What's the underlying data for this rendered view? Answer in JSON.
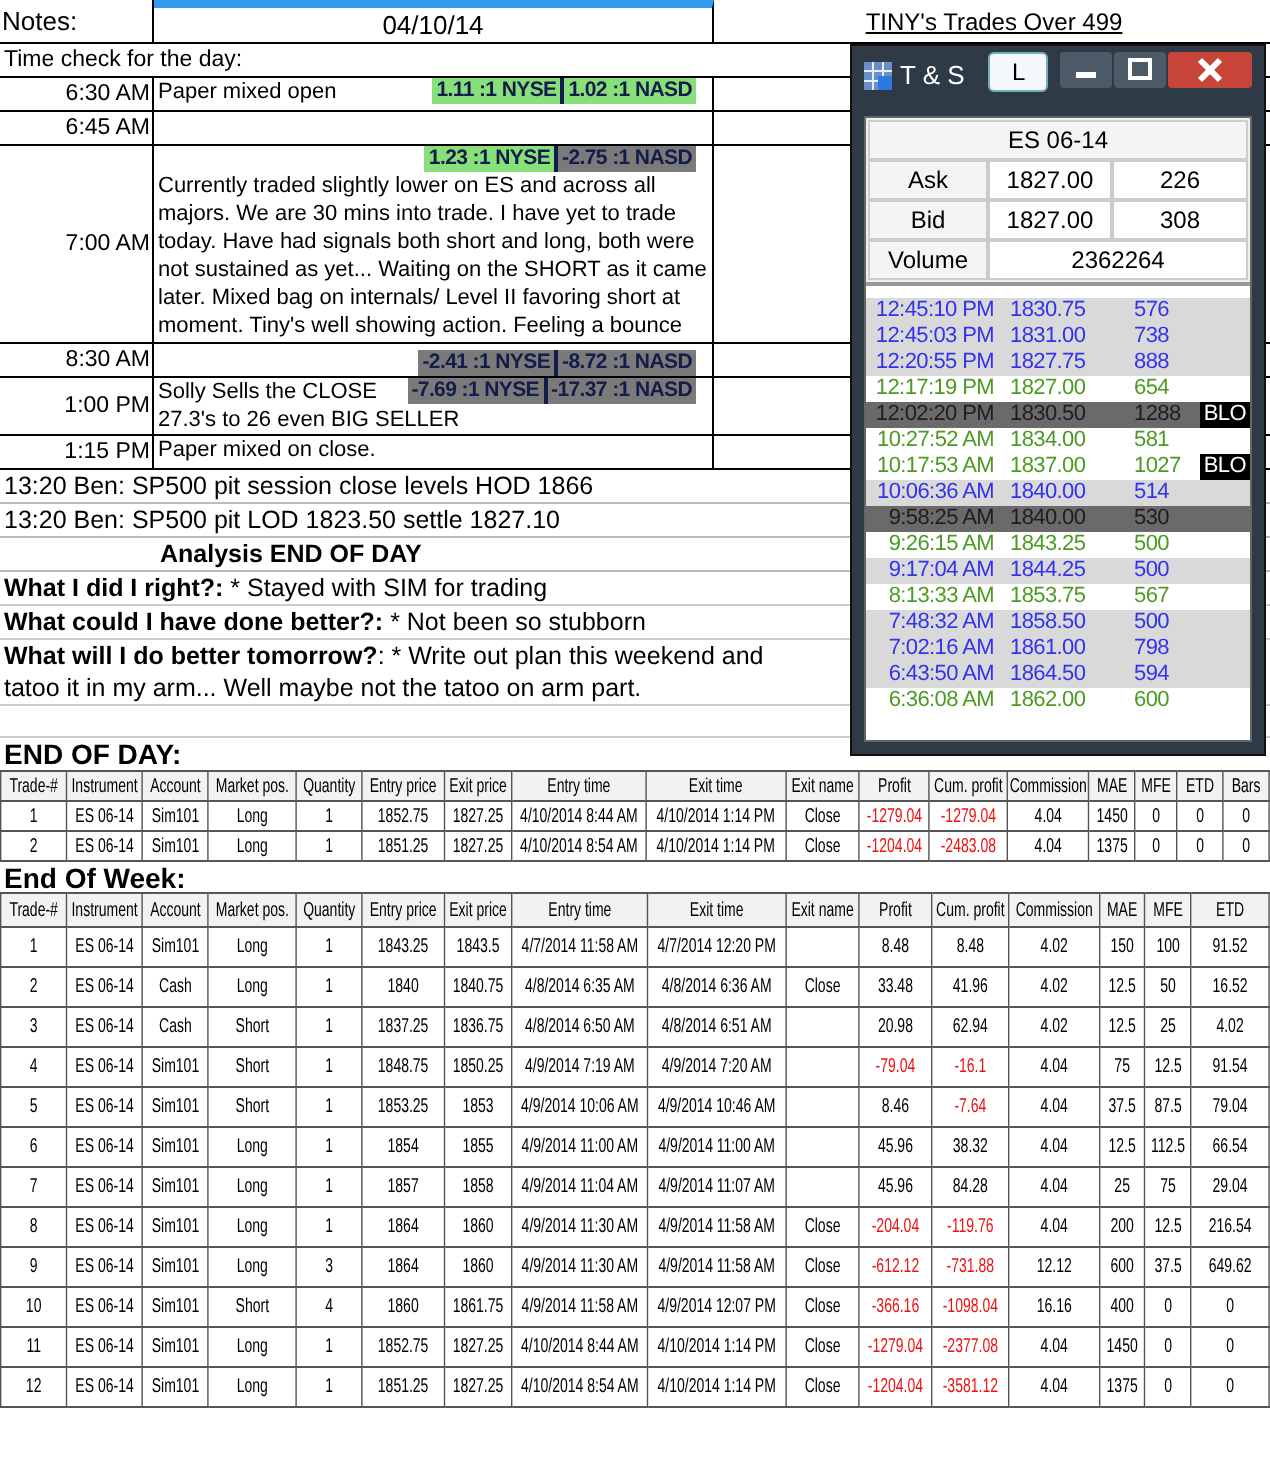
{
  "sheet": {
    "notes_label": "Notes:",
    "date": "04/10/14",
    "title": "TINY's Trades Over 499",
    "time_check": "Time check for the day:",
    "time_rows": [
      {
        "time": "6:30 AM",
        "kind": "overlay",
        "lines": [
          "Paper mixed open"
        ],
        "badges": [
          {
            "text": "1.11 :1 NYSE",
            "color": "#88e07a"
          },
          {
            "text": "1.02 :1 NASD",
            "color": "#88e07a"
          }
        ]
      },
      {
        "time": "6:45 AM",
        "kind": "overlay",
        "badges": []
      },
      {
        "time": "7:00 AM",
        "kind": "stacked",
        "lines": [
          "Currently traded slightly lower on ES and across all majors.   We are 30 mins into trade.  I have yet to trade today. Have had signals both short and long, both were not sustained as yet... Waiting on the SHORT as it came later.  Mixed bag on internals/ Level II favoring short at moment.  Tiny's well showing action.  Feeling a bounce"
        ],
        "badges": [
          {
            "text": "1.23 :1 NYSE",
            "color": "#88e07a"
          },
          {
            "text": "-2.75 :1 NASD",
            "color": "#7a7a7a"
          }
        ]
      },
      {
        "time": "8:30 AM",
        "kind": "overlay",
        "badges": [
          {
            "text": "-2.41 :1 NYSE",
            "color": "#7a7a7a"
          },
          {
            "text": "-8.72 :1 NASD",
            "color": "#7a7a7a"
          }
        ]
      },
      {
        "time": "1:00 PM",
        "kind": "overlay",
        "lines": [
          "Solly Sells the CLOSE",
          "27.3's to 26 even BIG SELLER"
        ],
        "badges": [
          {
            "text": "-7.69 :1 NYSE",
            "color": "#7a7a7a"
          },
          {
            "text": "-17.37 :1 NASD",
            "color": "#7a7a7a"
          }
        ]
      },
      {
        "time": "1:15 PM",
        "kind": "overlay",
        "lines": [
          "Paper mixed on close."
        ],
        "badges": []
      }
    ],
    "lines": [
      "13:20 Ben: SP500 pit session close levels HOD 1866",
      "13:20 Ben: SP500 pit  LOD 1823.50 settle 1827.10"
    ],
    "analysis_heading": "Analysis END OF DAY",
    "questions": [
      "**What I did I right?:** * Stayed with SIM for trading",
      "**What could I have done better?:** * Not been so stubborn",
      "**What will I do better tomorrow?**: * Write out plan this weekend and tatoo it in my arm... Well maybe not the tatoo on arm part."
    ]
  },
  "ts_window": {
    "title": "T & S",
    "l_button": "L",
    "instrument": "ES 06-14",
    "quote": [
      {
        "label": "Ask",
        "price": "1827.00",
        "size": "226"
      },
      {
        "label": "Bid",
        "price": "1827.00",
        "size": "308"
      }
    ],
    "volume_label": "Volume",
    "volume": "2362264",
    "trades": [
      {
        "time": "12:45:10 PM",
        "price": "1830.75",
        "size": "576",
        "color": "#3333ee",
        "shaded": true,
        "highlight": false
      },
      {
        "time": "12:45:03 PM",
        "price": "1831.00",
        "size": "738",
        "color": "#3333ee",
        "shaded": true,
        "highlight": false
      },
      {
        "time": "12:20:55 PM",
        "price": "1827.75",
        "size": "888",
        "color": "#3333ee",
        "shaded": true,
        "highlight": false
      },
      {
        "time": "12:17:19 PM",
        "price": "1827.00",
        "size": "654",
        "color": "#4c9a22",
        "shaded": false,
        "highlight": false
      },
      {
        "time": "12:02:20 PM",
        "price": "1830.50",
        "size": "1288",
        "highlight": true,
        "tag": "BLO"
      },
      {
        "time": "10:27:52 AM",
        "price": "1834.00",
        "size": "581",
        "color": "#4c9a22",
        "shaded": false,
        "highlight": false
      },
      {
        "time": "10:17:53 AM",
        "price": "1837.00",
        "size": "1027",
        "color": "#4c9a22",
        "shaded": false,
        "highlight": false,
        "tag": "BLO"
      },
      {
        "time": "10:06:36 AM",
        "price": "1840.00",
        "size": "514",
        "color": "#3333ee",
        "shaded": true,
        "highlight": false
      },
      {
        "time": "9:58:25 AM",
        "price": "1840.00",
        "size": "530",
        "highlight": true
      },
      {
        "time": "9:26:15 AM",
        "price": "1843.25",
        "size": "500",
        "color": "#4c9a22",
        "shaded": false,
        "highlight": false
      },
      {
        "time": "9:17:04 AM",
        "price": "1844.25",
        "size": "500",
        "color": "#3333ee",
        "shaded": true,
        "highlight": false
      },
      {
        "time": "8:13:33 AM",
        "price": "1853.75",
        "size": "567",
        "color": "#4c9a22",
        "shaded": false,
        "highlight": false
      },
      {
        "time": "7:48:32 AM",
        "price": "1858.50",
        "size": "500",
        "color": "#3333ee",
        "shaded": true,
        "highlight": false
      },
      {
        "time": "7:02:16 AM",
        "price": "1861.00",
        "size": "798",
        "color": "#3333ee",
        "shaded": true,
        "highlight": false
      },
      {
        "time": "6:43:50 AM",
        "price": "1864.50",
        "size": "594",
        "color": "#3333ee",
        "shaded": true,
        "highlight": false
      },
      {
        "time": "6:36:08 AM",
        "price": "1862.00",
        "size": "600",
        "color": "#4c9a22",
        "shaded": false,
        "highlight": false
      }
    ]
  },
  "end_of_day": {
    "heading": "END OF DAY:",
    "columns": [
      "Trade-#",
      "Instrument",
      "Account",
      "Market pos.",
      "Quantity",
      "Entry price",
      "Exit price",
      "Entry time",
      "Exit time",
      "Exit name",
      "Profit",
      "Cum. profit",
      "Commission",
      "MAE",
      "MFE",
      "ETD",
      "Bars"
    ],
    "rows": [
      {
        "cells": [
          "1",
          "ES 06-14",
          "Sim101",
          "Long",
          "1",
          "1852.75",
          "1827.25",
          "4/10/2014 8:44 AM",
          "4/10/2014 1:14 PM",
          "Close",
          "-1279.04",
          "-1279.04",
          "4.04",
          "1450",
          "0",
          "0",
          "0"
        ],
        "profit_loss": true,
        "cum_loss": true
      },
      {
        "cells": [
          "2",
          "ES 06-14",
          "Sim101",
          "Long",
          "1",
          "1851.25",
          "1827.25",
          "4/10/2014 8:54 AM",
          "4/10/2014 1:14 PM",
          "Close",
          "-1204.04",
          "-2483.08",
          "4.04",
          "1375",
          "0",
          "0",
          "0"
        ],
        "profit_loss": true,
        "cum_loss": true
      }
    ]
  },
  "end_of_week": {
    "heading": "End Of Week:",
    "columns": [
      "Trade-#",
      "Instrument",
      "Account",
      "Market pos.",
      "Quantity",
      "Entry price",
      "Exit price",
      "Entry time",
      "Exit time",
      "Exit name",
      "Profit",
      "Cum. profit",
      "Commission",
      "MAE",
      "MFE",
      "ETD"
    ],
    "rows": [
      {
        "cells": [
          "1",
          "ES 06-14",
          "Sim101",
          "Long",
          "1",
          "1843.25",
          "1843.5",
          "4/7/2014 11:58 AM",
          "4/7/2014 12:20 PM",
          null,
          "8.48",
          "8.48",
          "4.02",
          "150",
          "100",
          "91.52"
        ],
        "profit_loss": false,
        "cum_loss": false
      },
      {
        "cells": [
          "2",
          "ES 06-14",
          "Cash",
          "Long",
          "1",
          "1840",
          "1840.75",
          "4/8/2014 6:35 AM",
          "4/8/2014 6:36 AM",
          "Close",
          "33.48",
          "41.96",
          "4.02",
          "12.5",
          "50",
          "16.52"
        ],
        "profit_loss": false,
        "cum_loss": false
      },
      {
        "cells": [
          "3",
          "ES 06-14",
          "Cash",
          "Short",
          "1",
          "1837.25",
          "1836.75",
          "4/8/2014 6:50 AM",
          "4/8/2014 6:51 AM",
          null,
          "20.98",
          "62.94",
          "4.02",
          "12.5",
          "25",
          "4.02"
        ],
        "profit_loss": false,
        "cum_loss": false
      },
      {
        "cells": [
          "4",
          "ES 06-14",
          "Sim101",
          "Short",
          "1",
          "1848.75",
          "1850.25",
          "4/9/2014 7:19 AM",
          "4/9/2014 7:20 AM",
          null,
          "-79.04",
          "-16.1",
          "4.04",
          "75",
          "12.5",
          "91.54"
        ],
        "profit_loss": true,
        "cum_loss": true
      },
      {
        "cells": [
          "5",
          "ES 06-14",
          "Sim101",
          "Short",
          "1",
          "1853.25",
          "1853",
          "4/9/2014 10:06 AM",
          "4/9/2014 10:46 AM",
          null,
          "8.46",
          "-7.64",
          "4.04",
          "37.5",
          "87.5",
          "79.04"
        ],
        "profit_loss": false,
        "cum_loss": true
      },
      {
        "cells": [
          "6",
          "ES 06-14",
          "Sim101",
          "Long",
          "1",
          "1854",
          "1855",
          "4/9/2014 11:00 AM",
          "4/9/2014 11:00 AM",
          null,
          "45.96",
          "38.32",
          "4.04",
          "12.5",
          "112.5",
          "66.54"
        ],
        "profit_loss": false,
        "cum_loss": false
      },
      {
        "cells": [
          "7",
          "ES 06-14",
          "Sim101",
          "Long",
          "1",
          "1857",
          "1858",
          "4/9/2014 11:04 AM",
          "4/9/2014 11:07 AM",
          null,
          "45.96",
          "84.28",
          "4.04",
          "25",
          "75",
          "29.04"
        ],
        "profit_loss": false,
        "cum_loss": false
      },
      {
        "cells": [
          "8",
          "ES 06-14",
          "Sim101",
          "Long",
          "1",
          "1864",
          "1860",
          "4/9/2014 11:30 AM",
          "4/9/2014 11:58 AM",
          "Close",
          "-204.04",
          "-119.76",
          "4.04",
          "200",
          "12.5",
          "216.54"
        ],
        "profit_loss": true,
        "cum_loss": true
      },
      {
        "cells": [
          "9",
          "ES 06-14",
          "Sim101",
          "Long",
          "3",
          "1864",
          "1860",
          "4/9/2014 11:30 AM",
          "4/9/2014 11:58 AM",
          "Close",
          "-612.12",
          "-731.88",
          "12.12",
          "600",
          "37.5",
          "649.62"
        ],
        "profit_loss": true,
        "cum_loss": true
      },
      {
        "cells": [
          "10",
          "ES 06-14",
          "Sim101",
          "Short",
          "4",
          "1860",
          "1861.75",
          "4/9/2014 11:58 AM",
          "4/9/2014 12:07 PM",
          "Close",
          "-366.16",
          "-1098.04",
          "16.16",
          "400",
          "0",
          "0"
        ],
        "profit_loss": true,
        "cum_loss": true
      },
      {
        "cells": [
          "11",
          "ES 06-14",
          "Sim101",
          "Long",
          "1",
          "1852.75",
          "1827.25",
          "4/10/2014 8:44 AM",
          "4/10/2014 1:14 PM",
          "Close",
          "-1279.04",
          "-2377.08",
          "4.04",
          "1450",
          "0",
          "0"
        ],
        "profit_loss": true,
        "cum_loss": true
      },
      {
        "cells": [
          "12",
          "ES 06-14",
          "Sim101",
          "Long",
          "1",
          "1851.25",
          "1827.25",
          "4/10/2014 8:54 AM",
          "4/10/2014 1:14 PM",
          "Close",
          "-1204.04",
          "-3581.12",
          "4.04",
          "1375",
          "0",
          "0"
        ],
        "profit_loss": true,
        "cum_loss": true
      }
    ]
  }
}
